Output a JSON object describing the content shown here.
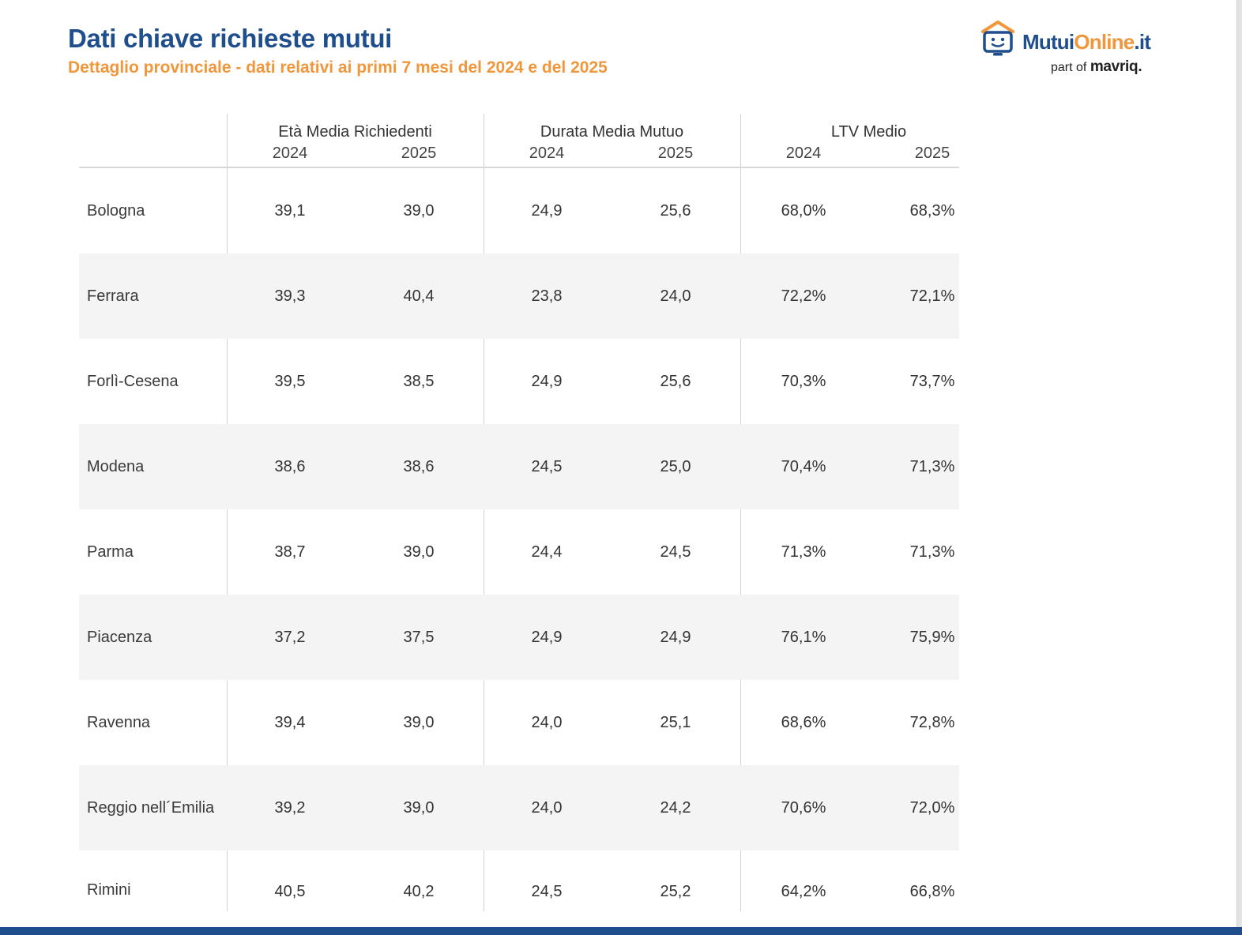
{
  "header": {
    "title": "Dati chiave richieste mutui",
    "subtitle": "Dettaglio provinciale - dati relativi ai primi 7 mesi del 2024 e del 2025"
  },
  "logo": {
    "word_part1": "Mutui",
    "word_part2": "Online",
    "word_part3": ".it",
    "tag_prefix": "part of",
    "tag_brand": "mavriq."
  },
  "colors": {
    "brand_blue": "#1f4e8c",
    "brand_orange": "#f0973b",
    "row_shade": "#f4f4f4"
  },
  "table": {
    "groups": [
      {
        "label": "Età Media Richiedenti",
        "years": [
          "2024",
          "2025"
        ]
      },
      {
        "label": "Durata Media Mutuo",
        "years": [
          "2024",
          "2025"
        ]
      },
      {
        "label": "LTV Medio",
        "years": [
          "2024",
          "2025"
        ]
      }
    ],
    "rows": [
      {
        "province": "Bologna",
        "values": [
          "39,1",
          "39,0",
          "24,9",
          "25,6",
          "68,0%",
          "68,3%"
        ]
      },
      {
        "province": "Ferrara",
        "values": [
          "39,3",
          "40,4",
          "23,8",
          "24,0",
          "72,2%",
          "72,1%"
        ]
      },
      {
        "province": "Forlì-Cesena",
        "values": [
          "39,5",
          "38,5",
          "24,9",
          "25,6",
          "70,3%",
          "73,7%"
        ]
      },
      {
        "province": "Modena",
        "values": [
          "38,6",
          "38,6",
          "24,5",
          "25,0",
          "70,4%",
          "71,3%"
        ]
      },
      {
        "province": "Parma",
        "values": [
          "38,7",
          "39,0",
          "24,4",
          "24,5",
          "71,3%",
          "71,3%"
        ]
      },
      {
        "province": "Piacenza",
        "values": [
          "37,2",
          "37,5",
          "24,9",
          "24,9",
          "76,1%",
          "75,9%"
        ]
      },
      {
        "province": "Ravenna",
        "values": [
          "39,4",
          "39,0",
          "24,0",
          "25,1",
          "68,6%",
          "72,8%"
        ]
      },
      {
        "province": "Reggio nell´Emilia",
        "values": [
          "39,2",
          "39,0",
          "24,0",
          "24,2",
          "70,6%",
          "72,0%"
        ]
      },
      {
        "province": "Rimini",
        "values": [
          "40,5",
          "40,2",
          "24,5",
          "25,2",
          "64,2%",
          "66,8%"
        ]
      }
    ]
  }
}
